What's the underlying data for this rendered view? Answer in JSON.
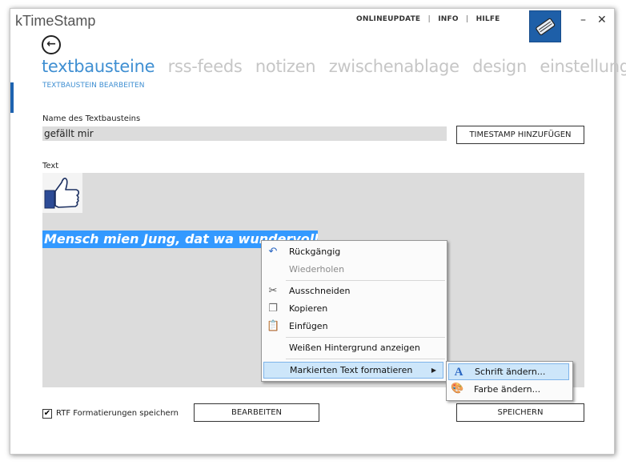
{
  "window": {
    "title": "kTimeStamp"
  },
  "topmenu": {
    "items": [
      "ONLINEUPDATE",
      "INFO",
      "HILFE"
    ]
  },
  "controls": {
    "minimize": "–",
    "close": "✕"
  },
  "nav": {
    "tabs": [
      "textbausteine",
      "rss-feeds",
      "notizen",
      "zwischenablage",
      "design",
      "einstellungen"
    ],
    "active": "textbausteine",
    "subtitle": "TEXTBAUSTEIN BEARBEITEN"
  },
  "form": {
    "name_label": "Name des Textbausteins",
    "name_value": "gefällt mir",
    "timestamp_button": "TIMESTAMP HINZUFÜGEN",
    "text_label": "Text",
    "selected_text": "Mensch mien Jung, dat wa wundervoll!",
    "rtf_checkbox": "RTF Formatierungen speichern",
    "rtf_checked": "✔",
    "edit_button": "BEARBEITEN",
    "save_button": "SPEICHERN"
  },
  "context_menu": {
    "items": {
      "undo": "Rückgängig",
      "redo": "Wiederholen",
      "cut": "Ausschneiden",
      "copy": "Kopieren",
      "paste": "Einfügen",
      "white_bg": "Weißen Hintergrund anzeigen",
      "format": "Markierten Text formatieren"
    }
  },
  "submenu": {
    "font": "Schrift ändern...",
    "color": "Farbe ändern..."
  },
  "colors": {
    "accent": "#3f8fd2",
    "selection": "#3399ff",
    "field": "#dcdcdc",
    "brand": "#1e5fa8"
  }
}
